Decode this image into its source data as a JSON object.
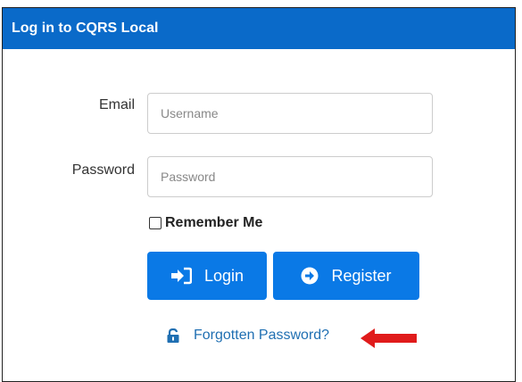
{
  "header": {
    "title": "Log in to CQRS Local"
  },
  "form": {
    "email_label": "Email",
    "email_placeholder": "Username",
    "password_label": "Password",
    "password_placeholder": "Password",
    "remember_label": "Remember Me"
  },
  "buttons": {
    "login_label": "Login",
    "login_icon": "sign-in-icon",
    "register_label": "Register",
    "register_icon": "arrow-circle-right-icon"
  },
  "links": {
    "forgot_label": "Forgotten Password?",
    "forgot_icon": "unlock-icon"
  },
  "annotation": {
    "arrow_color": "#e01b1b",
    "arrow_icon": "red-left-arrow-icon"
  },
  "colors": {
    "header_bg": "#0a6ac9",
    "button_bg": "#0a79e6",
    "link": "#1f6fb2"
  }
}
